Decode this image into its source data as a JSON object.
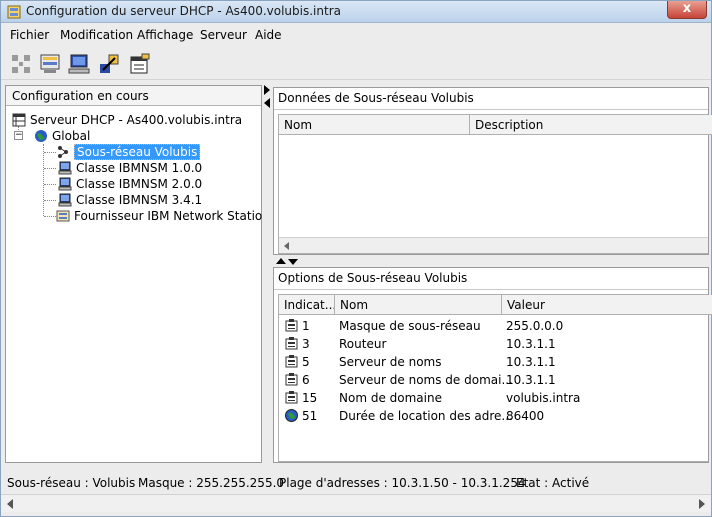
{
  "window": {
    "title": "Configuration du serveur DHCP - As400.volubis.intra",
    "close_label": "x"
  },
  "menu": [
    "Fichier",
    "Modification",
    "Affichage",
    "Serveur",
    "Aide"
  ],
  "toolbar": {
    "buttons": [
      "network-icon",
      "server-config-icon",
      "workstation-icon",
      "wizard-icon",
      "properties-icon"
    ]
  },
  "left_pane": {
    "header": "Configuration en cours",
    "tree": [
      {
        "label": "Serveur DHCP - As400.volubis.intra",
        "icon": "server-icon",
        "level": 0
      },
      {
        "label": "Global",
        "icon": "globe-icon",
        "level": 1
      },
      {
        "label": "Sous-réseau Volubis",
        "icon": "subnet-icon",
        "level": 2,
        "selected": true
      },
      {
        "label": "Classe IBMNSM 1.0.0",
        "icon": "class-icon",
        "level": 2
      },
      {
        "label": "Classe IBMNSM 2.0.0",
        "icon": "class-icon",
        "level": 2
      },
      {
        "label": "Classe IBMNSM 3.4.1",
        "icon": "class-icon",
        "level": 2
      },
      {
        "label": "Fournisseur IBM Network Station",
        "icon": "vendor-icon",
        "level": 2
      }
    ]
  },
  "data_panel": {
    "title": "Données de Sous-réseau Volubis",
    "columns": [
      "Nom",
      "Description"
    ]
  },
  "options_panel": {
    "title": "Options de Sous-réseau Volubis",
    "columns": [
      "Indicat...",
      "Nom",
      "Valeur"
    ],
    "rows": [
      {
        "id": "1",
        "name": "Masque de sous-réseau",
        "value": "255.0.0.0"
      },
      {
        "id": "3",
        "name": "Routeur",
        "value": "10.3.1.1"
      },
      {
        "id": "5",
        "name": "Serveur de noms",
        "value": "10.3.1.1"
      },
      {
        "id": "6",
        "name": "Serveur de noms de domai...",
        "value": "10.3.1.1"
      },
      {
        "id": "15",
        "name": "Nom de domaine",
        "value": "volubis.intra"
      },
      {
        "id": "51",
        "name": "Durée de location des adre...",
        "value": "86400"
      }
    ]
  },
  "status": {
    "subnet": "Sous-réseau : Volubis",
    "mask": "Masque : 255.255.255.0",
    "range": "Plage d'adresses : 10.3.1.50 - 10.3.1.254",
    "state": "Etat : Activé"
  },
  "colors": {
    "selection": "#3399ff",
    "window_bg": "#ececec",
    "title_gradient": "#bcd2ea",
    "close": "#c7443a"
  }
}
